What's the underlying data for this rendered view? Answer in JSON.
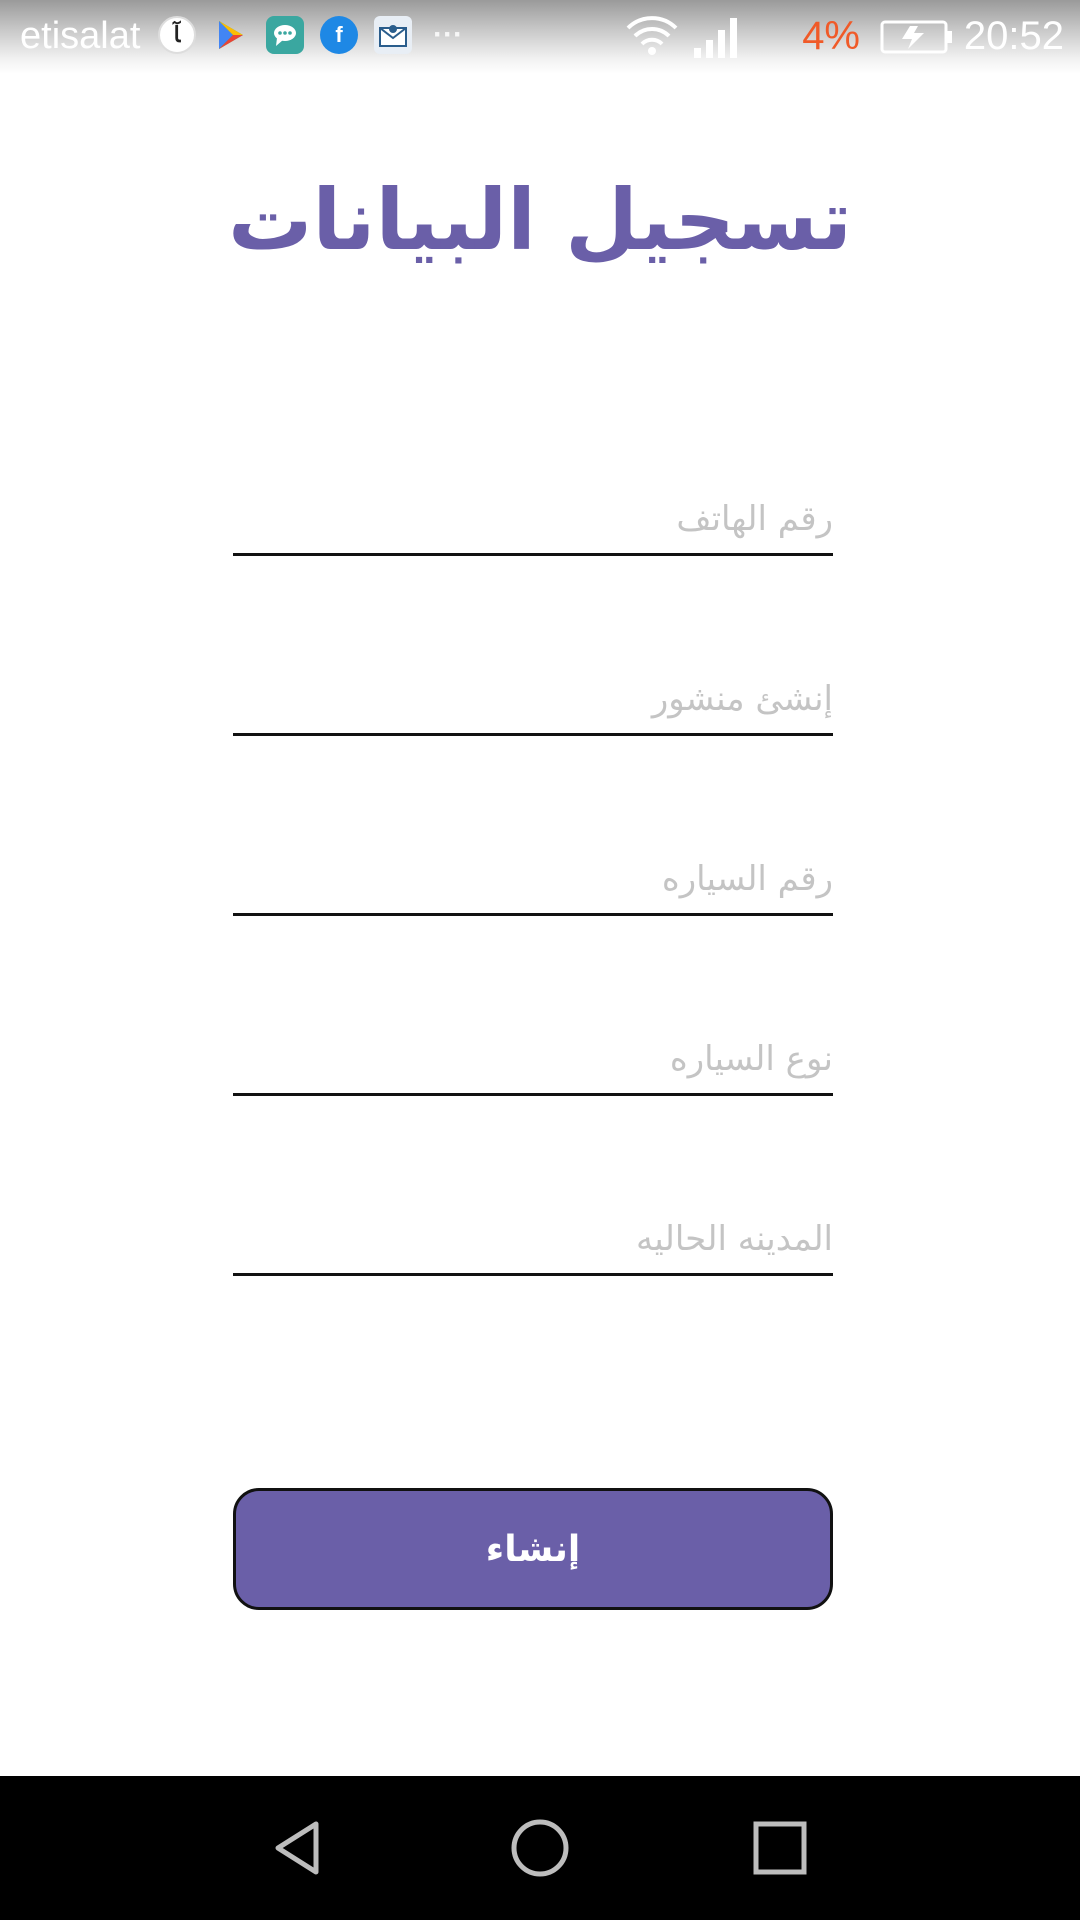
{
  "status_bar": {
    "carrier": "etisalat",
    "notification_icons": [
      "app-icon",
      "play-store-icon",
      "messages-icon",
      "facebook-icon",
      "mail-icon"
    ],
    "more_indicator": "···",
    "battery_percent": "4%",
    "time": "20:52",
    "battery_percent_color": "#f05a28"
  },
  "page": {
    "title": "تسجيل البيانات",
    "title_color": "#6a5fa8"
  },
  "form": {
    "fields": [
      {
        "placeholder": "رقم الهاتف",
        "value": ""
      },
      {
        "placeholder": "إنشئ منشور",
        "value": ""
      },
      {
        "placeholder": "رقم السياره",
        "value": ""
      },
      {
        "placeholder": "نوع السياره",
        "value": ""
      },
      {
        "placeholder": "المدينه الحاليه",
        "value": ""
      }
    ],
    "submit_label": "إنشاء",
    "submit_color": "#6a5fa8"
  },
  "nav_bar": {
    "buttons": [
      "back-icon",
      "home-icon",
      "recents-icon"
    ]
  }
}
